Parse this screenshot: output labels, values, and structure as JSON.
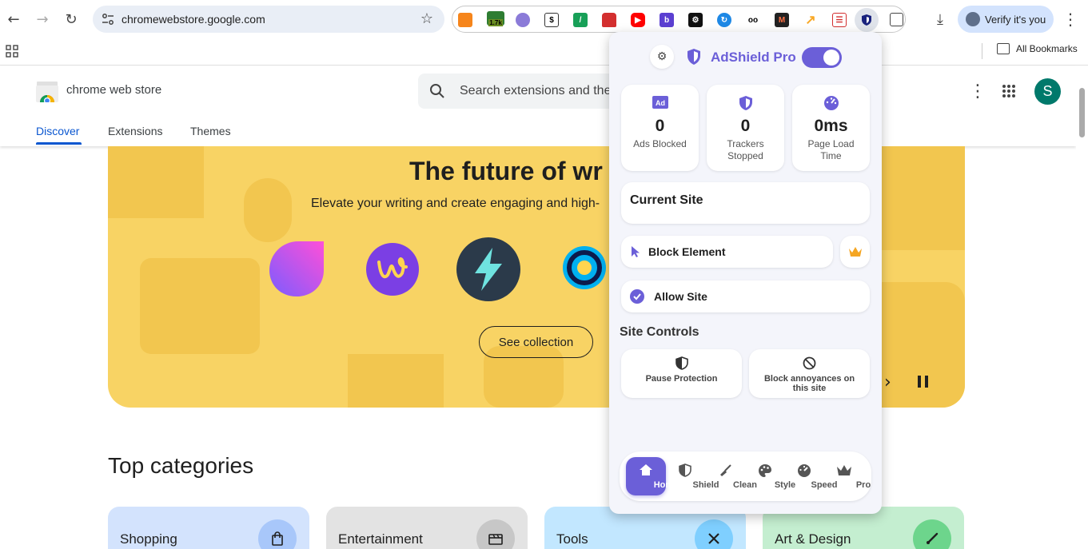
{
  "browser": {
    "url": "chromewebstore.google.com",
    "verify_label": "Verify it's you",
    "ext_badge": "1.7k",
    "all_bookmarks": "All Bookmarks"
  },
  "store": {
    "name": "chrome web store",
    "search_placeholder": "Search extensions and the",
    "tabs": [
      "Discover",
      "Extensions",
      "Themes"
    ],
    "avatar_initial": "S"
  },
  "banner": {
    "title": "The future of wr",
    "subtitle": "Elevate your writing and create engaging and high-",
    "button": "See collection"
  },
  "categories": {
    "heading": "Top categories",
    "items": [
      {
        "label": "Shopping",
        "icon": "shopping-bag-icon",
        "color": "#d3e3fd"
      },
      {
        "label": "Entertainment",
        "icon": "movie-icon",
        "color": "#e3e3e3"
      },
      {
        "label": "Tools",
        "icon": "tools-icon",
        "color": "#c2e7ff"
      },
      {
        "label": "Art & Design",
        "icon": "brush-icon",
        "color": "#c4eed0"
      }
    ]
  },
  "popup": {
    "brand": "AdShield Pro",
    "toggle_on": true,
    "accent": "#6b5fd8",
    "stats": [
      {
        "value": "0",
        "label": "Ads Blocked",
        "icon": "ad-icon"
      },
      {
        "value": "0",
        "label": "Trackers Stopped",
        "icon": "shield-icon"
      },
      {
        "value": "0ms",
        "label": "Page Load Time",
        "icon": "gauge-icon"
      }
    ],
    "current_site": "Current Site",
    "block_element": "Block Element",
    "allow_site": "Allow Site",
    "site_controls": "Site Controls",
    "pause_protection": "Pause Protection",
    "block_annoyances": "Block annoyances on this site",
    "nav": [
      "Home",
      "Shield",
      "Clean",
      "Style",
      "Speed",
      "Pro"
    ]
  }
}
